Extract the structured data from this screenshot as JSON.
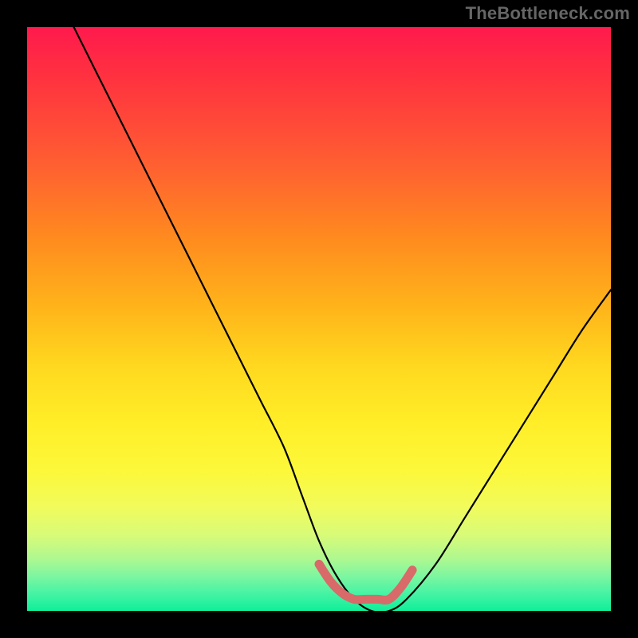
{
  "watermark": "TheBottleneck.com",
  "colors": {
    "frame": "#000000",
    "curve": "#000000",
    "marker": "#d86a6a",
    "watermark": "#666666"
  },
  "chart_data": {
    "type": "line",
    "title": "",
    "xlabel": "",
    "ylabel": "",
    "xlim": [
      0,
      100
    ],
    "ylim": [
      0,
      100
    ],
    "grid": false,
    "legend": false,
    "series": [
      {
        "name": "bottleneck-curve",
        "x": [
          8,
          12,
          16,
          20,
          24,
          28,
          32,
          36,
          40,
          44,
          47,
          50,
          53,
          56,
          59,
          62,
          65,
          70,
          75,
          80,
          85,
          90,
          95,
          100
        ],
        "y": [
          100,
          92,
          84,
          76,
          68,
          60,
          52,
          44,
          36,
          28,
          20,
          12,
          6,
          2,
          0,
          0,
          2,
          8,
          16,
          24,
          32,
          40,
          48,
          55
        ]
      },
      {
        "name": "sweet-spot-marker",
        "x": [
          50,
          52,
          54,
          56,
          58,
          60,
          62,
          64,
          66
        ],
        "y": [
          8,
          5,
          3,
          2,
          2,
          2,
          2,
          4,
          7
        ]
      }
    ],
    "annotations": [
      {
        "text": "TheBottleneck.com",
        "role": "watermark",
        "position": "top-right"
      }
    ]
  }
}
